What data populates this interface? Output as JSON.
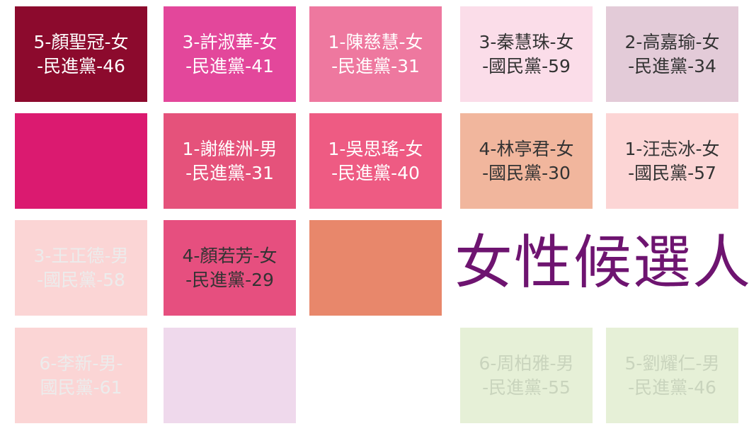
{
  "label": {
    "text": "女性候選人",
    "color": "#6e1470"
  },
  "tiles": [
    {
      "bg": "#8c0a2d",
      "fg": "#ffffff",
      "line1": "5-顏聖冠-女",
      "line2": "-民進黨-46"
    },
    {
      "bg": "#e3479b",
      "fg": "#ffffff",
      "line1": "3-許淑華-女",
      "line2": "-民進黨-41"
    },
    {
      "bg": "#ee789f",
      "fg": "#ffffff",
      "line1": "1-陳慈慧-女",
      "line2": "-民進黨-31"
    },
    {
      "bg": "#fbdde9",
      "fg": "#333333",
      "line1": "3-秦慧珠-女",
      "line2": "-國民黨-59"
    },
    {
      "bg": "#e3cbd8",
      "fg": "#333333",
      "line1": "2-高嘉瑜-女",
      "line2": "-民進黨-34"
    },
    {
      "bg": "#db1a70",
      "fg": "#ffffff",
      "line1": "",
      "line2": ""
    },
    {
      "bg": "#e5527b",
      "fg": "#ffffff",
      "line1": "1-謝維洲-男",
      "line2": "-民進黨-31"
    },
    {
      "bg": "#ee5b83",
      "fg": "#ffffff",
      "line1": "1-吳思瑤-女",
      "line2": "-民進黨-40"
    },
    {
      "bg": "#f1b69d",
      "fg": "#333333",
      "line1": "4-林亭君-女",
      "line2": "-國民黨-30"
    },
    {
      "bg": "#fcd5d5",
      "fg": "#333333",
      "line1": "1-汪志冰-女",
      "line2": "-國民黨-57"
    },
    {
      "bg": "#fbd5d5",
      "fg": "#ececec",
      "line1": "3-王正德-男",
      "line2": "-國民黨-58"
    },
    {
      "bg": "#e64f7f",
      "fg": "#333333",
      "line1": "4-顏若芳-女",
      "line2": "-民進黨-29"
    },
    {
      "bg": "#e8876b",
      "fg": "#ffffff",
      "line1": "",
      "line2": ""
    },
    {
      "bg": "#fbd5d5",
      "fg": "#ececec",
      "line1": "6-李新-男-",
      "line2": "國民黨-61"
    },
    {
      "bg": "#efd9ec",
      "fg": "#ececec",
      "line1": "",
      "line2": ""
    },
    {
      "bg": "#e6f0d7",
      "fg": "#c9d4bd",
      "line1": "6-周柏雅-男",
      "line2": "-民進黨-55"
    },
    {
      "bg": "#e6f0d7",
      "fg": "#c9d4bd",
      "line1": "5-劉耀仁-男",
      "line2": "-民進黨-46"
    }
  ]
}
